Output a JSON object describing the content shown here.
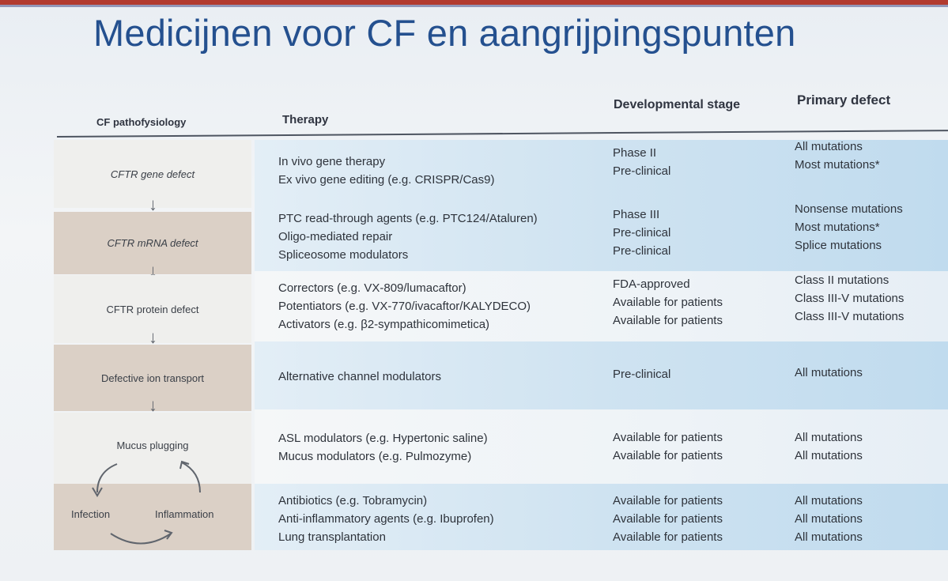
{
  "title": "Medicijnen voor CF en aangrijpingspunten",
  "headers": {
    "pathophysiology": "CF pathofysiology",
    "therapy": "Therapy",
    "stage": "Developmental stage",
    "defect": "Primary defect"
  },
  "rows": [
    {
      "patho": "CFTR gene defect",
      "therapy": [
        "In vivo gene therapy",
        "Ex vivo gene editing (e.g. CRISPR/Cas9)"
      ],
      "stage": [
        "Phase II",
        "Pre-clinical"
      ],
      "defect": [
        "All mutations",
        "Most mutations*"
      ]
    },
    {
      "patho": "CFTR mRNA defect",
      "therapy": [
        "PTC read-through agents (e.g. PTC124/Ataluren)",
        "Oligo-mediated repair",
        "Spliceosome modulators"
      ],
      "stage": [
        "Phase III",
        "Pre-clinical",
        "Pre-clinical"
      ],
      "defect": [
        "Nonsense mutations",
        "Most mutations*",
        "Splice mutations"
      ]
    },
    {
      "patho": "CFTR protein defect",
      "therapy": [
        "Correctors (e.g. VX-809/lumacaftor)",
        "Potentiators (e.g. VX-770/ivacaftor/KALYDECO)",
        "Activators (e.g. β2-sympathicomimetica)"
      ],
      "stage": [
        "FDA-approved",
        "Available for patients",
        "Available for patients"
      ],
      "defect": [
        "Class II mutations",
        "Class III-V mutations",
        "Class III-V mutations"
      ]
    },
    {
      "patho": "Defective ion transport",
      "therapy": [
        "Alternative channel modulators"
      ],
      "stage": [
        "Pre-clinical"
      ],
      "defect": [
        "All mutations"
      ]
    },
    {
      "patho": "Mucus plugging",
      "therapy": [
        "ASL modulators (e.g. Hypertonic saline)",
        "Mucus modulators (e.g. Pulmozyme)"
      ],
      "stage": [
        "Available for patients",
        "Available for patients"
      ],
      "defect": [
        "All mutations",
        "All mutations"
      ]
    },
    {
      "patho_left": "Infection",
      "patho_right": "Inflammation",
      "therapy": [
        "Antibiotics (e.g. Tobramycin)",
        "Anti-inflammatory agents (e.g. Ibuprofen)",
        "Lung transplantation"
      ],
      "stage": [
        "Available for patients",
        "Available for patients",
        "Available for patients"
      ],
      "defect": [
        "All mutations",
        "All mutations",
        "All mutations"
      ]
    }
  ],
  "colors": {
    "title": "#24508f",
    "band_blue": "#c0dbee",
    "patho_tan": "#dbd0c6",
    "top_accent": "#b23a2f"
  }
}
